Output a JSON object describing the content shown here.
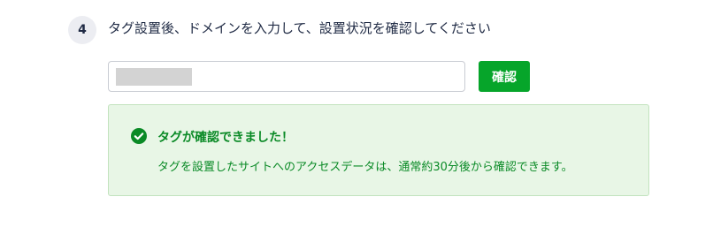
{
  "step": {
    "number": "4",
    "title": "タグ設置後、ドメインを入力して、設置状況を確認してください"
  },
  "domain_input": {
    "value": "",
    "placeholder": ""
  },
  "confirm_button": {
    "label": "確認"
  },
  "result": {
    "title": "タグが確認できました！",
    "message": "タグを設置したサイトへのアクセスデータは、通常約30分後から確認できます。",
    "icon": "check-circle-icon"
  },
  "colors": {
    "accent": "#06a52a",
    "success_text": "#0a8a26",
    "success_bg": "#e8f6e6",
    "success_border": "#c2e3be",
    "badge_bg": "#ecedf2",
    "title_text": "#1f2a44"
  }
}
